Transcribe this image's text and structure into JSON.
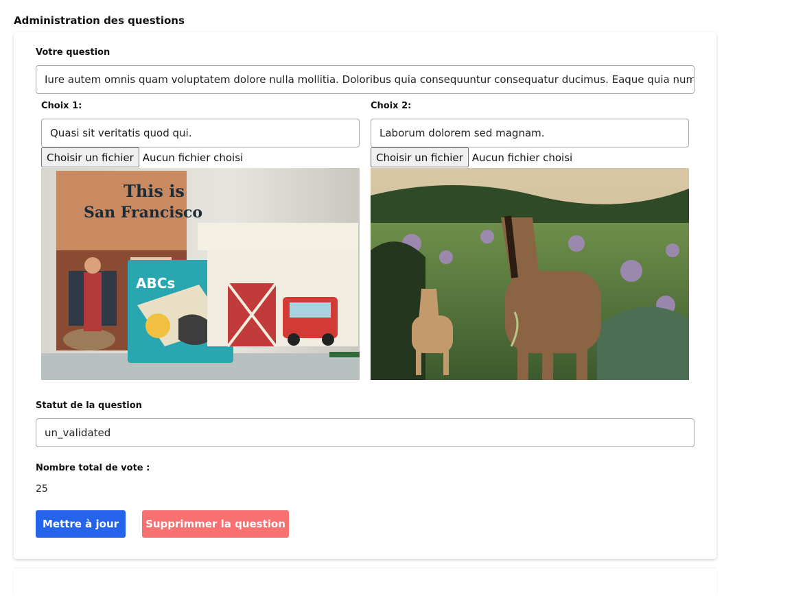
{
  "page": {
    "title": "Administration des questions"
  },
  "question": {
    "label": "Votre question",
    "value": "Iure autem omnis quam voluptatem dolore nulla mollitia. Doloribus quia consequuntur consequatur ducimus. Eaque quia numquam"
  },
  "choices": [
    {
      "label": "Choix 1:",
      "value": "Quasi sit veritatis quod qui.",
      "file_button": "Choisir un fichier",
      "file_status": "Aucun fichier choisi",
      "image_book_title_line1": "This is",
      "image_book_title_line2": "San Francisco",
      "image_book2_title": "ABCs"
    },
    {
      "label": "Choix 2:",
      "value": "Laborum dolorem sed magnam.",
      "file_button": "Choisir un fichier",
      "file_status": "Aucun fichier choisi"
    }
  ],
  "status": {
    "label": "Statut de la question",
    "value": "un_validated"
  },
  "votes": {
    "label": "Nombre total de vote :",
    "value": "25"
  },
  "actions": {
    "update_label": "Mettre à jour",
    "delete_label": "Supprimmer la question"
  },
  "colors": {
    "primary": "#2563eb",
    "danger": "#f87171"
  },
  "icons": {
    "choice_1_image": "toys-and-books-photo",
    "choice_2_image": "horses-in-meadow-photo"
  }
}
